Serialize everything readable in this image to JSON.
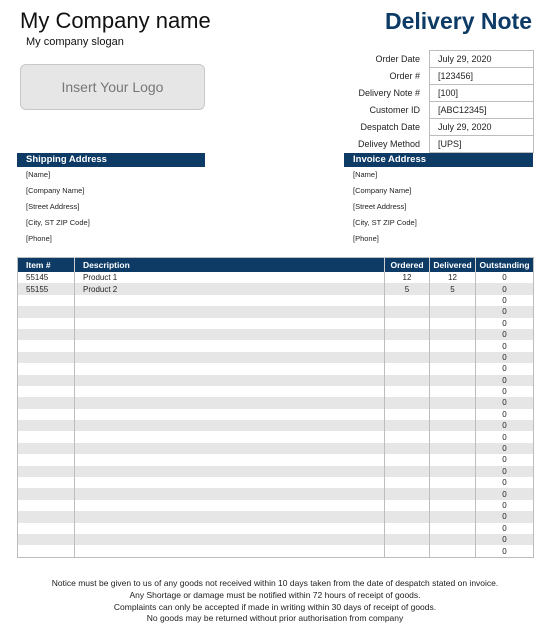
{
  "header": {
    "company_name": "My Company name",
    "slogan": "My company slogan",
    "logo_placeholder": "Insert Your Logo",
    "title": "Delivery Note"
  },
  "meta": [
    {
      "label": "Order Date",
      "value": "July 29, 2020"
    },
    {
      "label": "Order #",
      "value": "[123456]"
    },
    {
      "label": "Delivery Note #",
      "value": "[100]"
    },
    {
      "label": "Customer ID",
      "value": "[ABC12345]"
    },
    {
      "label": "Despatch Date",
      "value": "July 29, 2020"
    },
    {
      "label": "Delivey Method",
      "value": "[UPS]"
    }
  ],
  "shipping": {
    "title": "Shipping Address",
    "lines": [
      "[Name]",
      "[Company Name]",
      "[Street Address]",
      "[City, ST  ZIP Code]",
      "[Phone]"
    ]
  },
  "invoice": {
    "title": "Invoice Address",
    "lines": [
      "[Name]",
      "[Company Name]",
      "[Street Address]",
      "[City, ST  ZIP Code]",
      "[Phone]"
    ]
  },
  "items": {
    "columns": [
      "Item #",
      "Description",
      "Ordered",
      "Delivered",
      "Outstanding"
    ],
    "rows": [
      {
        "item": "55145",
        "description": "Product 1",
        "ordered": "12",
        "delivered": "12",
        "outstanding": "0"
      },
      {
        "item": "55155",
        "description": "Product 2",
        "ordered": "5",
        "delivered": "5",
        "outstanding": "0"
      },
      {
        "item": "",
        "description": "",
        "ordered": "",
        "delivered": "",
        "outstanding": "0"
      },
      {
        "item": "",
        "description": "",
        "ordered": "",
        "delivered": "",
        "outstanding": "0"
      },
      {
        "item": "",
        "description": "",
        "ordered": "",
        "delivered": "",
        "outstanding": "0"
      },
      {
        "item": "",
        "description": "",
        "ordered": "",
        "delivered": "",
        "outstanding": "0"
      },
      {
        "item": "",
        "description": "",
        "ordered": "",
        "delivered": "",
        "outstanding": "0"
      },
      {
        "item": "",
        "description": "",
        "ordered": "",
        "delivered": "",
        "outstanding": "0"
      },
      {
        "item": "",
        "description": "",
        "ordered": "",
        "delivered": "",
        "outstanding": "0"
      },
      {
        "item": "",
        "description": "",
        "ordered": "",
        "delivered": "",
        "outstanding": "0"
      },
      {
        "item": "",
        "description": "",
        "ordered": "",
        "delivered": "",
        "outstanding": "0"
      },
      {
        "item": "",
        "description": "",
        "ordered": "",
        "delivered": "",
        "outstanding": "0"
      },
      {
        "item": "",
        "description": "",
        "ordered": "",
        "delivered": "",
        "outstanding": "0"
      },
      {
        "item": "",
        "description": "",
        "ordered": "",
        "delivered": "",
        "outstanding": "0"
      },
      {
        "item": "",
        "description": "",
        "ordered": "",
        "delivered": "",
        "outstanding": "0"
      },
      {
        "item": "",
        "description": "",
        "ordered": "",
        "delivered": "",
        "outstanding": "0"
      },
      {
        "item": "",
        "description": "",
        "ordered": "",
        "delivered": "",
        "outstanding": "0"
      },
      {
        "item": "",
        "description": "",
        "ordered": "",
        "delivered": "",
        "outstanding": "0"
      },
      {
        "item": "",
        "description": "",
        "ordered": "",
        "delivered": "",
        "outstanding": "0"
      },
      {
        "item": "",
        "description": "",
        "ordered": "",
        "delivered": "",
        "outstanding": "0"
      },
      {
        "item": "",
        "description": "",
        "ordered": "",
        "delivered": "",
        "outstanding": "0"
      },
      {
        "item": "",
        "description": "",
        "ordered": "",
        "delivered": "",
        "outstanding": "0"
      },
      {
        "item": "",
        "description": "",
        "ordered": "",
        "delivered": "",
        "outstanding": "0"
      },
      {
        "item": "",
        "description": "",
        "ordered": "",
        "delivered": "",
        "outstanding": "0"
      },
      {
        "item": "",
        "description": "",
        "ordered": "",
        "delivered": "",
        "outstanding": "0"
      }
    ]
  },
  "footer": {
    "lines": [
      "Notice must be given to us of any goods not received within 10 days taken from the date of despatch stated on invoice.",
      "Any Shortage or damage must be notified within 72 hours of receipt of goods.",
      "Complaints can only be accepted if made in writing within 30 days of receipt of goods.",
      "No goods may be returned without prior authorisation from company"
    ]
  },
  "colors": {
    "brand": "#0d3b66",
    "row_alt": "#e6e6e6",
    "border": "#bdbdbd"
  }
}
